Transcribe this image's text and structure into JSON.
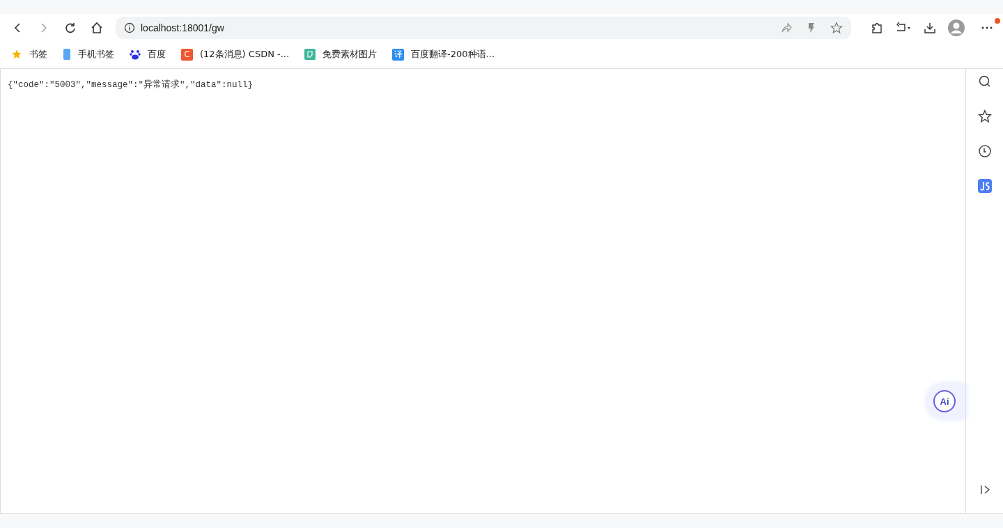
{
  "address_bar": {
    "url": "localhost:18001/gw"
  },
  "bookmarks": [
    {
      "kind": "star",
      "label": "书签"
    },
    {
      "kind": "phone",
      "label": "手机书签"
    },
    {
      "kind": "paw",
      "label": "百度"
    },
    {
      "kind": "letter",
      "glyph": "C",
      "color": "#f0562f",
      "label": "(12条消息) CSDN -..."
    },
    {
      "kind": "square",
      "color": "#3fb59c",
      "label": "免费素材图片"
    },
    {
      "kind": "letter",
      "glyph": "译",
      "color": "#2d8cf0",
      "label": "百度翻译-200种语..."
    }
  ],
  "page": {
    "body": "{\"code\":\"5003\",\"message\":\"异常请求\",\"data\":null}"
  },
  "ai_button": {
    "label": "Ai"
  },
  "menu": {
    "notification": true
  }
}
